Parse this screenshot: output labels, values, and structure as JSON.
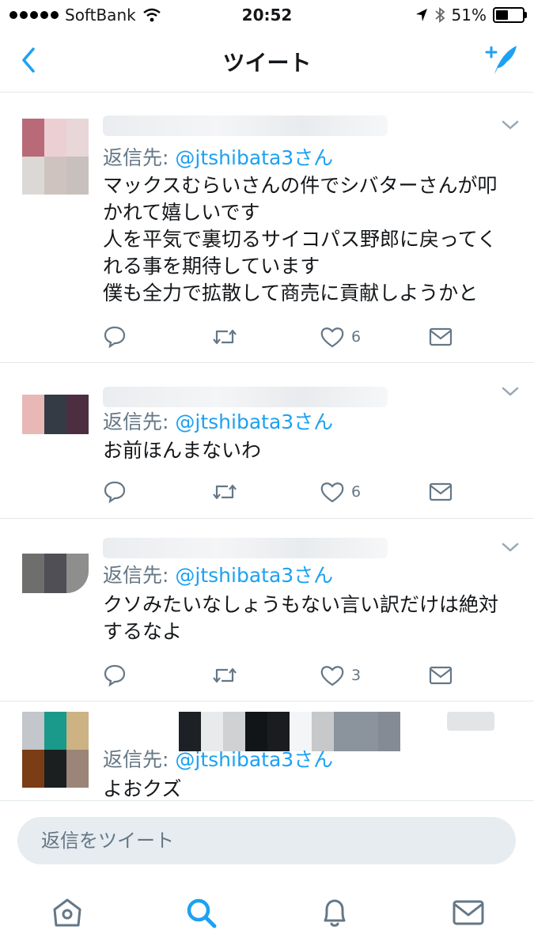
{
  "status_bar": {
    "carrier": "SoftBank",
    "time": "20:52",
    "battery": "51%",
    "battery_level": 0.51
  },
  "nav": {
    "title": "ツイート",
    "back_icon": "chevron-left-icon",
    "compose_icon": "compose-tweet-icon"
  },
  "tweets": [
    {
      "reply_prefix": "返信先:",
      "reply_handle": "@jtshibata3さん",
      "text": "マックスむらいさんの件でシバターさんが叩かれて嬉しいです\n人を平気で裏切るサイコパス野郎に戻ってくれる事を期待しています\n僕も全力で拡散して商売に貢献しようかと",
      "likes": "6"
    },
    {
      "reply_prefix": "返信先:",
      "reply_handle": "@jtshibata3さん",
      "text": "お前ほんまないわ",
      "likes": "6"
    },
    {
      "reply_prefix": "返信先:",
      "reply_handle": "@jtshibata3さん",
      "text": "クソみたいなしょうもない言い訳だけは絶対するなよ",
      "likes": "3"
    },
    {
      "reply_prefix": "返信先:",
      "reply_handle": "@jtshibata3さん",
      "text": "よおクズ",
      "likes": ""
    }
  ],
  "reply_box": {
    "placeholder": "返信をツイート"
  },
  "tabbar": {
    "items": [
      "home-icon",
      "search-icon",
      "notifications-icon",
      "messages-icon"
    ],
    "active": "search-icon"
  },
  "colors": {
    "accent": "#1da1f2",
    "secondary_text": "#657786",
    "divider": "#e1e8ed"
  }
}
